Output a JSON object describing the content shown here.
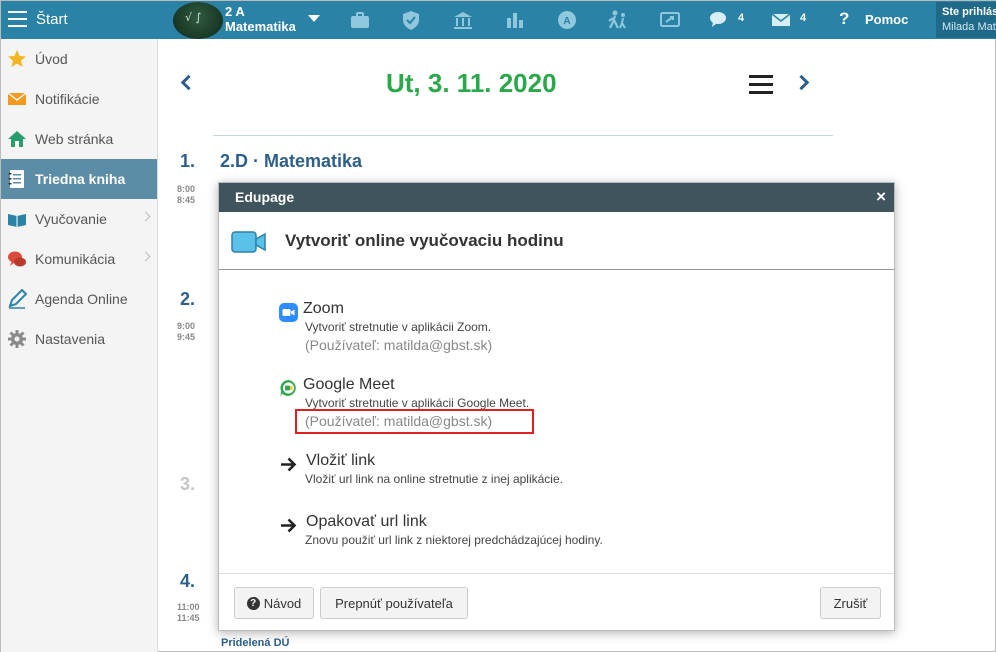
{
  "topbar": {
    "start_label": "Štart",
    "subject_line1": "2 A",
    "subject_line2": "Matematika",
    "chat_count": "4",
    "mail_count": "4",
    "help_symbol": "?",
    "help_label": "Pomoc",
    "user_line1": "Ste prihlásený ako",
    "user_line2": "Milada Matildová"
  },
  "sidebar": {
    "items": [
      {
        "label": "Úvod",
        "icon": "star-icon"
      },
      {
        "label": "Notifikácie",
        "icon": "envelope-icon"
      },
      {
        "label": "Web stránka",
        "icon": "house-icon"
      },
      {
        "label": "Triedna kniha",
        "icon": "notebook-icon"
      },
      {
        "label": "Vyučovanie",
        "icon": "book-icon"
      },
      {
        "label": "Komunikácia",
        "icon": "chat-bubbles-icon"
      },
      {
        "label": "Agenda Online",
        "icon": "pen-icon"
      },
      {
        "label": "Nastavenia",
        "icon": "gear-icon"
      }
    ]
  },
  "main": {
    "date": "Ut, 3. 11. 2020",
    "lessons": [
      {
        "num": "1.",
        "start": "8:00",
        "end": "8:45"
      },
      {
        "num": "2.",
        "start": "9:00",
        "end": "9:45"
      },
      {
        "num": "3."
      },
      {
        "num": "4.",
        "start": "11:00",
        "end": "11:45"
      }
    ],
    "lesson1_title": "2.D · Matematika",
    "homework_label": "Pridelená DÚ"
  },
  "modal": {
    "header": "Edupage",
    "close": "×",
    "title": "Vytvoriť online vyučovaciu hodinu",
    "options": [
      {
        "title": "Zoom",
        "desc": "Vytvoriť stretnutie v aplikácii Zoom.",
        "user": "(Používateľ: matilda@gbst.sk)",
        "icon": "zoom-icon"
      },
      {
        "title": "Google Meet",
        "desc": "Vytvoriť stretnutie v aplikácii Google Meet.",
        "user": "(Používateľ: matilda@gbst.sk)",
        "icon": "google-meet-icon"
      },
      {
        "title": "Vložiť link",
        "desc": "Vložiť url link na online stretnutie z inej aplikácie.",
        "icon": "arrow-right-icon"
      },
      {
        "title": "Opakovať url link",
        "desc": "Znovu použiť url link z niektorej predchádzajúcej hodiny.",
        "icon": "arrow-right-icon"
      }
    ],
    "buttons": {
      "help": "Návod",
      "switch_user": "Prepnúť používateľa",
      "cancel": "Zrušiť"
    }
  },
  "colors": {
    "topbar": "#2a83a6",
    "date_green": "#2aa84a",
    "lesson_blue": "#2e5f8a",
    "sidebar_active": "#5b8ea6",
    "modal_header": "#40545e",
    "highlight_red": "#e02020"
  }
}
